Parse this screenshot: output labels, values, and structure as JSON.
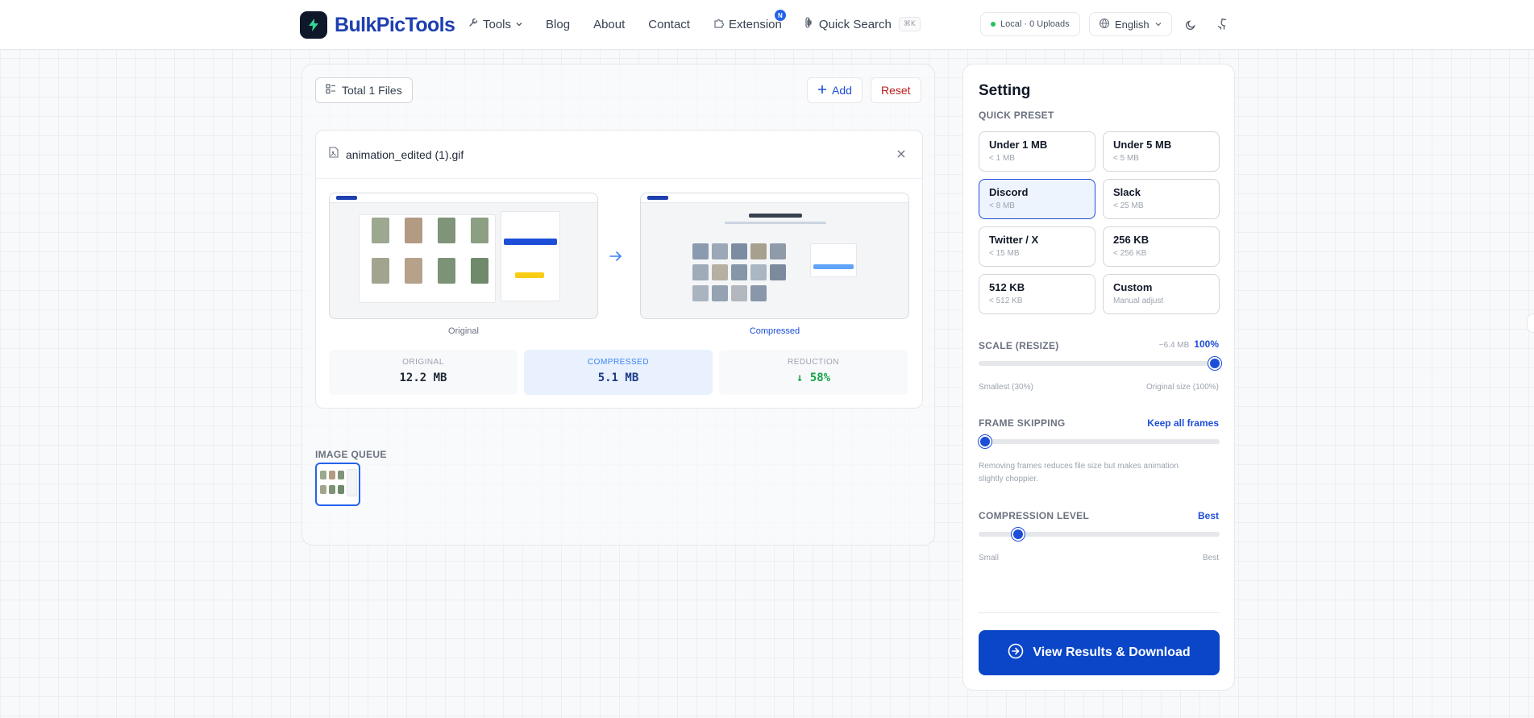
{
  "header": {
    "brand": "BulkPicTools",
    "nav": {
      "tools": "Tools",
      "blog": "Blog",
      "about": "About",
      "contact": "Contact",
      "extension": "Extension",
      "extension_badge": "N",
      "quick_search": "Quick Search",
      "quick_search_shortcut": "⌘K"
    },
    "status": "Local · 0 Uploads",
    "language": "English",
    "icons": [
      "lightning-icon",
      "wrench-icon",
      "chevron-down-icon",
      "puzzle-icon",
      "command-icon",
      "globe-icon",
      "moon-icon",
      "github-icon"
    ]
  },
  "toolbar": {
    "total": "Total 1 Files",
    "add": "Add",
    "reset": "Reset"
  },
  "file": {
    "name": "animation_edited (1).gif",
    "preview_original_caption": "Original",
    "preview_compressed_caption": "Compressed",
    "stats": {
      "original_label": "ORIGINAL",
      "original_value": "12.2 MB",
      "compressed_label": "COMPRESSED",
      "compressed_value": "5.1 MB",
      "reduction_label": "REDUCTION",
      "reduction_value": "↓ 58%"
    }
  },
  "queue": {
    "label": "IMAGE QUEUE"
  },
  "settings": {
    "title": "Setting",
    "preset_label": "QUICK PRESET",
    "presets": [
      {
        "name": "Under 1 MB",
        "sub": "< 1 MB"
      },
      {
        "name": "Under 5 MB",
        "sub": "< 5 MB"
      },
      {
        "name": "Discord",
        "sub": "< 8 MB"
      },
      {
        "name": "Slack",
        "sub": "< 25 MB"
      },
      {
        "name": "Twitter / X",
        "sub": "< 15 MB"
      },
      {
        "name": "256 KB",
        "sub": "< 256 KB"
      },
      {
        "name": "512 KB",
        "sub": "< 512 KB"
      },
      {
        "name": "Custom",
        "sub": "Manual adjust"
      }
    ],
    "active_preset": "Discord",
    "scale": {
      "label": "SCALE (RESIZE)",
      "estimate": "~6.4 MB",
      "value_text": "100%",
      "value": 100,
      "min_label": "Smallest (30%)",
      "max_label": "Original size (100%)"
    },
    "frames": {
      "label": "FRAME SKIPPING",
      "value_text": "Keep all frames",
      "value": 0,
      "help": "Removing frames reduces file size but makes animation slightly choppier."
    },
    "compression": {
      "label": "COMPRESSION LEVEL",
      "value_text": "Best",
      "level": 0.165,
      "min_label": "Small",
      "max_label": "Best"
    },
    "cta": "View Results & Download"
  },
  "colors": {
    "accent": "#1d4ed8",
    "cta": "#0b46c8",
    "reset": "#b91c1c",
    "success": "#16a34a",
    "status_dot": "#22c55e"
  }
}
